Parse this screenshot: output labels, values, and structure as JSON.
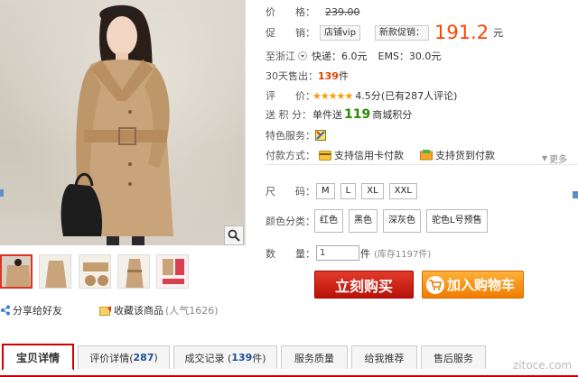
{
  "price": {
    "label": "价　　格：",
    "original": "239.00"
  },
  "promo": {
    "label": "促　　销：",
    "store_tag": "店铺vip",
    "promo_tag": "新款促销：",
    "price": "191.2",
    "unit": "元"
  },
  "shipping": {
    "label": "至浙江",
    "express": "快递：6.0元",
    "ems": "EMS：30.0元"
  },
  "sold": {
    "label": "30天售出：",
    "count": "139",
    "unit": "件"
  },
  "rating": {
    "label": "评　　价：",
    "stars": "★★★★★",
    "score": "4.5分",
    "reviews": "(已有287人评论)"
  },
  "points": {
    "label": "送 积 分：",
    "prefix": "单件送",
    "value": "119",
    "suffix": "商城积分"
  },
  "features": {
    "label": "特色服务："
  },
  "payment": {
    "label": "付款方式：",
    "credit": "支持信用卡付款",
    "cod": "支持货到付款",
    "more": "更多"
  },
  "size": {
    "label": "尺　　码：",
    "options": [
      "M",
      "L",
      "XL",
      "XXL"
    ]
  },
  "color": {
    "label": "颜色分类：",
    "options": [
      "红色",
      "黑色",
      "深灰色",
      "驼色L号预售"
    ]
  },
  "quantity": {
    "label": "数　　量：",
    "value": "1",
    "unit": "件",
    "stock": "(库存1197件)"
  },
  "buy_button": "立刻购买",
  "cart_button": "加入购物车",
  "share": {
    "share_label": "分享给好友",
    "collect_label": "收藏该商品",
    "popularity": "(人气1626)"
  },
  "tabs": [
    {
      "label": "宝贝详情",
      "count": ""
    },
    {
      "label": "评价详情(",
      "count": "287",
      "close": ")"
    },
    {
      "label": "成交记录 (",
      "count": "139",
      "close": "件)"
    },
    {
      "label": "服务质量",
      "count": ""
    },
    {
      "label": "给我推荐",
      "count": ""
    },
    {
      "label": "售后服务",
      "count": ""
    }
  ],
  "watermark": "zitoce.com",
  "colors": {
    "accent": "#ff4400",
    "buy": "#c8180d",
    "cart": "#f58a10",
    "tab_border": "#cc0000"
  },
  "icons": [
    "magnifier-icon",
    "share-icon",
    "collect-icon",
    "credit-card-icon",
    "cod-icon",
    "cart-icon",
    "feature-badge-icon",
    "dropdown-icon"
  ]
}
